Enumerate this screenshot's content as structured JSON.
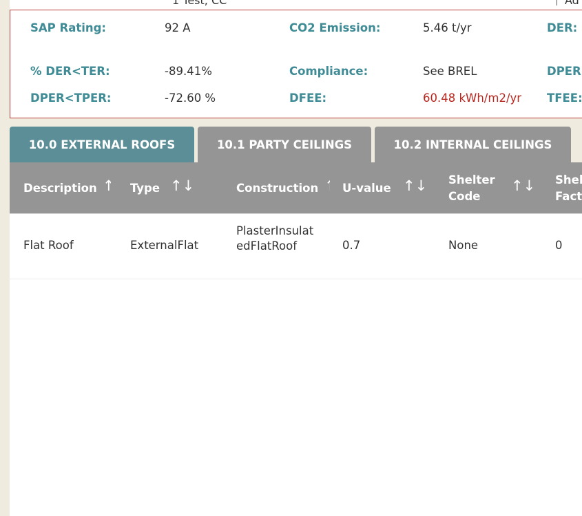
{
  "top_strip": {
    "left_text": "1 Test, CC",
    "right_text": "Ad"
  },
  "summary": {
    "sap_rating_label": "SAP Rating:",
    "sap_rating_value": "92 A",
    "co2_label": "CO2 Emission:",
    "co2_value": "5.46 t/yr",
    "der_label": "DER:",
    "der_ter_label": "% DER<TER:",
    "der_ter_value": "-89.41%",
    "compliance_label": "Compliance:",
    "compliance_value": "See BREL",
    "dper_label": "DPER",
    "dper_tper_label": "DPER<TPER:",
    "dper_tper_value": "-72.60 %",
    "dfee_label": "DFEE:",
    "dfee_value": "60.48 kWh/m2/yr",
    "tfee_label": "TFEE:",
    "colors": {
      "label": "#3f8b96",
      "alert": "#b8271f",
      "border": "#b83a36"
    }
  },
  "tabs": [
    {
      "label": "10.0 EXTERNAL ROOFS",
      "active": true
    },
    {
      "label": "10.1 PARTY CEILINGS",
      "active": false
    },
    {
      "label": "10.2 INTERNAL CEILINGS",
      "active": false
    }
  ],
  "table": {
    "columns": {
      "description": "Description",
      "type": "Type",
      "construction": "Construction",
      "u_value": "U-value",
      "shelter_code_line1": "Shelter",
      "shelter_code_line2": "Code",
      "shelter_factor_line1": "Shel",
      "shelter_factor_line2": "Fact"
    },
    "sort_icon": "sort-arrows-icon",
    "rows": [
      {
        "description": "Flat Roof",
        "type": "ExternalFlat",
        "construction": "PlasterInsulatedFlatRoof",
        "u_value": "0.7",
        "shelter_code": "None",
        "shelter_factor": "0"
      }
    ]
  }
}
